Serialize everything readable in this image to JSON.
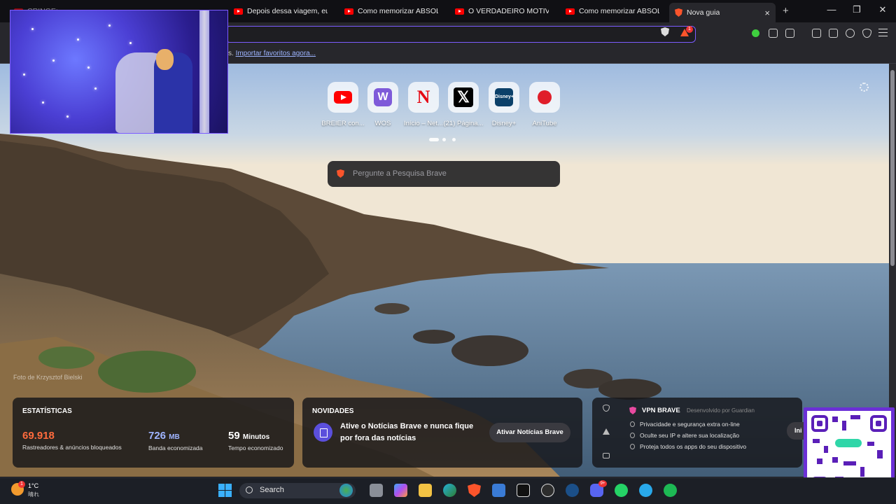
{
  "tabs": [
    {
      "title": "CRINGE: ...",
      "icon": "youtube-icon"
    },
    {
      "title": "Depois dessa viagem, eu pr",
      "icon": "youtube-icon"
    },
    {
      "title": "Como memorizar ABSOLUTA",
      "icon": "youtube-icon"
    },
    {
      "title": "O VERDADEIRO MOTIVO DE",
      "icon": "youtube-icon"
    },
    {
      "title": "Como memorizar ABSOLUTA",
      "icon": "youtube-icon"
    },
    {
      "title": "Nova guia",
      "icon": "brave-icon",
      "active": true
    }
  ],
  "toolbar": {
    "rewards_badge": "1"
  },
  "bookmarks": {
    "prefix": "s.",
    "import_link": "Importar favoritos agora..."
  },
  "top_sites": [
    {
      "label": "BREIER con...",
      "icon": "youtube-icon"
    },
    {
      "label": "WOS",
      "icon": "wos-icon",
      "glyph": "W"
    },
    {
      "label": "Início – Net...",
      "icon": "netflix-icon",
      "glyph": "N"
    },
    {
      "label": "(21) Página...",
      "icon": "x-icon",
      "glyph": "𝕏"
    },
    {
      "label": "Disney+",
      "icon": "disney-icon",
      "glyph": "Disney+"
    },
    {
      "label": "AniTube",
      "icon": "apple-icon"
    }
  ],
  "search": {
    "placeholder": "Pergunte a Pesquisa Brave"
  },
  "photo_credit": "Foto de Krzysztof Bielski",
  "stats": {
    "title": "ESTATÍSTICAS",
    "trackers_value": "69.918",
    "trackers_label": "Rastreadores & anúncios bloqueados",
    "bandwidth_value": "726",
    "bandwidth_unit": "MB",
    "bandwidth_label": "Banda economizada",
    "time_value": "59",
    "time_unit": "Minutos",
    "time_label": "Tempo economizado",
    "trackers_color": "#ff6b3d",
    "bandwidth_color": "#9fb4ff"
  },
  "news": {
    "title": "NOVIDADES",
    "message": "Ative o Notícias Brave e nunca fique por fora das notícias",
    "button_label": "Ativar Notícias Brave"
  },
  "vpn": {
    "title": "VPN BRAVE",
    "by": "Desenvolvido por  Guardian",
    "items": [
      "Privacidade e segurança extra on-line",
      "Oculte seu IP e altere sua localização",
      "Proteja todos os apps do seu dispositivo"
    ],
    "button_label": "Ini"
  },
  "taskbar": {
    "weather_badge": "1",
    "temperature": "1°C",
    "condition": "晴れ",
    "search_label": "Search",
    "apps": [
      "google-earth-icon",
      "files-icon",
      "copilot-icon",
      "file-explorer-icon",
      "edge-icon",
      "brave-icon",
      "store-icon",
      "capcut-icon",
      "chatgpt-icon",
      "steam-icon",
      "discord-icon",
      "whatsapp-icon",
      "telegram-icon",
      "spotify-icon"
    ],
    "discord_badge": "9+"
  }
}
